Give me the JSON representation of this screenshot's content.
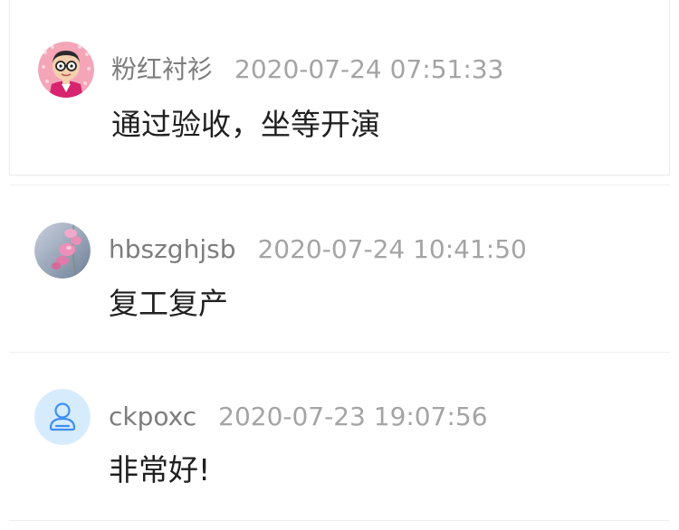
{
  "comments": [
    {
      "username": "粉红衬衫",
      "timestamp": "2020-07-24 07:51:33",
      "text": "通过验收，坐等开演",
      "avatar_icon": "cartoon-face-avatar-icon"
    },
    {
      "username": "hbszghjsb",
      "timestamp": "2020-07-24 10:41:50",
      "text": "复工复产",
      "avatar_icon": "flower-photo-avatar-icon"
    },
    {
      "username": "ckpoxc",
      "timestamp": "2020-07-23 19:07:56",
      "text": "非常好!",
      "avatar_icon": "default-user-avatar-icon"
    }
  ],
  "colors": {
    "username": "#7d7d7d",
    "timestamp": "#a4a4a4",
    "content": "#202020",
    "divider": "#efefef",
    "default_avatar_bg": "#d6ecfd",
    "default_avatar_icon": "#3f8ff5"
  }
}
